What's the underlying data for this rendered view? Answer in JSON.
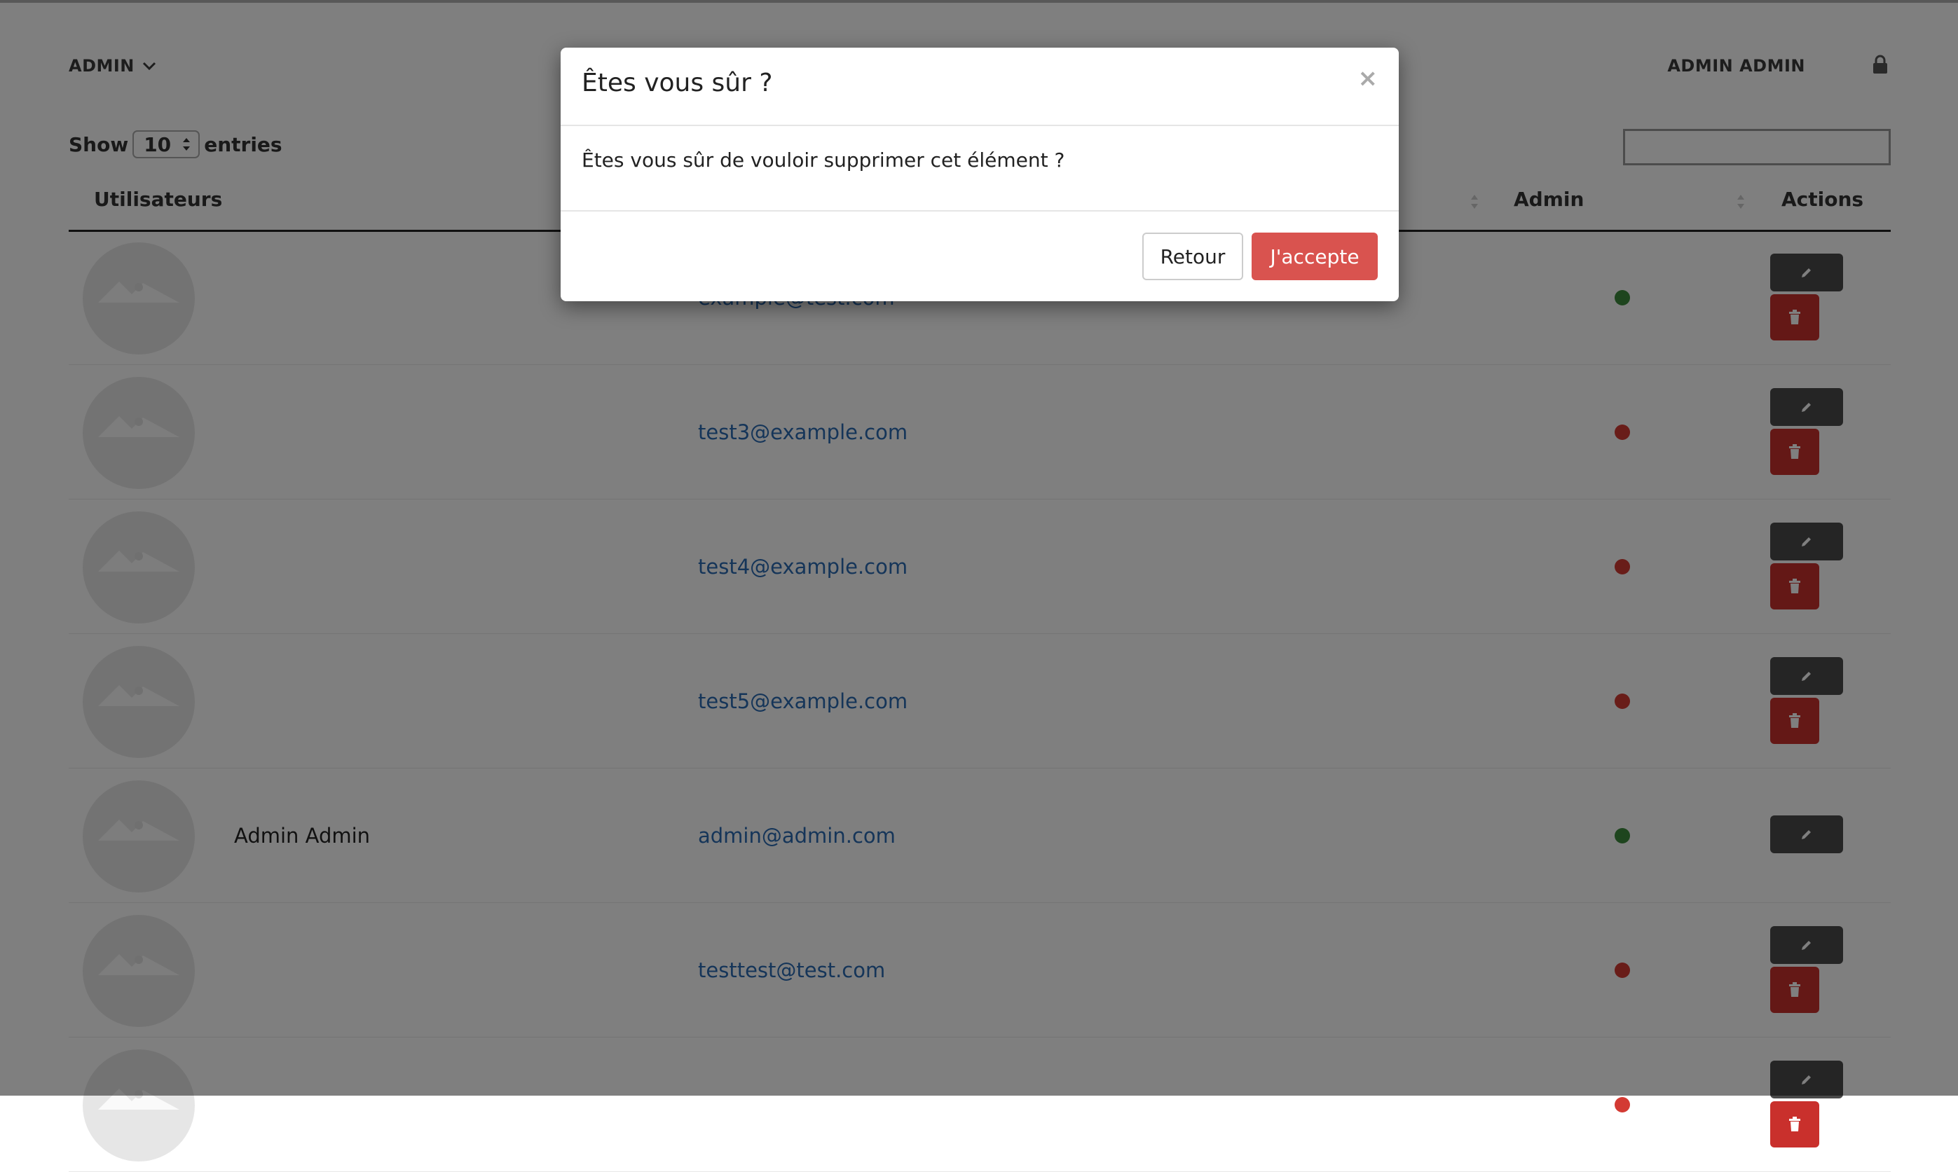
{
  "nav": {
    "menu_label": "ADMIN",
    "user_label": "ADMIN ADMIN",
    "menu_icon": "chevron-down-icon",
    "logout_icon": "lock-icon"
  },
  "table_controls": {
    "show_label": "Show",
    "page_length": "10",
    "entries_label": "entries",
    "search_value": ""
  },
  "table": {
    "headers": {
      "users": "Utilisateurs",
      "admin": "Admin",
      "actions": "Actions"
    },
    "rows": [
      {
        "name": "",
        "email": "example@test.com",
        "admin": true,
        "can_delete": true
      },
      {
        "name": "",
        "email": "test3@example.com",
        "admin": false,
        "can_delete": true
      },
      {
        "name": "",
        "email": "test4@example.com",
        "admin": false,
        "can_delete": true
      },
      {
        "name": "",
        "email": "test5@example.com",
        "admin": false,
        "can_delete": true
      },
      {
        "name": "Admin Admin",
        "email": "admin@admin.com",
        "admin": true,
        "can_delete": false
      },
      {
        "name": "",
        "email": "testtest@test.com",
        "admin": false,
        "can_delete": true
      },
      {
        "name": "",
        "email": "",
        "admin": false,
        "can_delete": true
      }
    ]
  },
  "colors": {
    "admin_yes": "#3c8a3c",
    "admin_no": "#d33a33",
    "accent_link": "#2a6ab2",
    "danger": "#d9534f"
  },
  "modal": {
    "title": "Êtes vous sûr ?",
    "close_glyph": "×",
    "body": "Êtes vous sûr de vouloir supprimer cet élément ?",
    "back_label": "Retour",
    "accept_label": "J'accepte"
  }
}
